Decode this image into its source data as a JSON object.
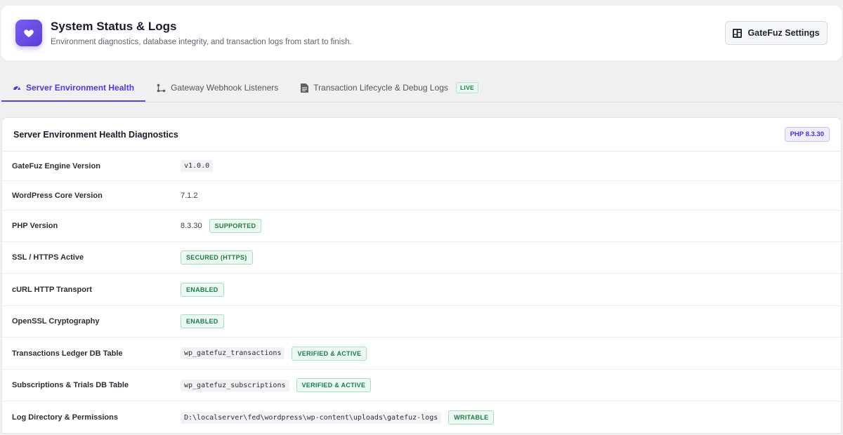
{
  "header": {
    "title": "System Status & Logs",
    "subtitle": "Environment diagnostics, database integrity, and transaction logs from start to finish.",
    "settings_label": "GateFuz Settings"
  },
  "tabs": [
    {
      "label": "Server Environment Health",
      "icon": "gauge-icon",
      "active": true
    },
    {
      "label": "Gateway Webhook Listeners",
      "icon": "webhook-icon",
      "active": false
    },
    {
      "label": "Transaction Lifecycle & Debug Logs",
      "icon": "document-icon",
      "active": false,
      "badge": "LIVE"
    }
  ],
  "panel": {
    "title": "Server Environment Health Diagnostics",
    "php_badge": "PHP 8.3.30"
  },
  "rows": [
    {
      "label": "GateFuz Engine Version",
      "code": "v1.0.0"
    },
    {
      "label": "WordPress Core Version",
      "text": "7.1.2"
    },
    {
      "label": "PHP Version",
      "text": "8.3.30",
      "badge": "SUPPORTED"
    },
    {
      "label": "SSL / HTTPS Active",
      "badge": "SECURED (HTTPS)"
    },
    {
      "label": "cURL HTTP Transport",
      "badge": "ENABLED"
    },
    {
      "label": "OpenSSL Cryptography",
      "badge": "ENABLED"
    },
    {
      "label": "Transactions Ledger DB Table",
      "code": "wp_gatefuz_transactions",
      "badge": "VERIFIED & ACTIVE"
    },
    {
      "label": "Subscriptions & Trials DB Table",
      "code": "wp_gatefuz_subscriptions",
      "badge": "VERIFIED & ACTIVE"
    },
    {
      "label": "Log Directory & Permissions",
      "code": "D:\\localserver\\fed\\wordpress\\wp-content\\uploads\\gatefuz-logs",
      "badge": "WRITABLE"
    }
  ],
  "colors": {
    "accent": "#5b45db",
    "success": "#1d7a48",
    "logo_gradient_start": "#7c5cf0",
    "logo_gradient_end": "#5b3fd6"
  }
}
